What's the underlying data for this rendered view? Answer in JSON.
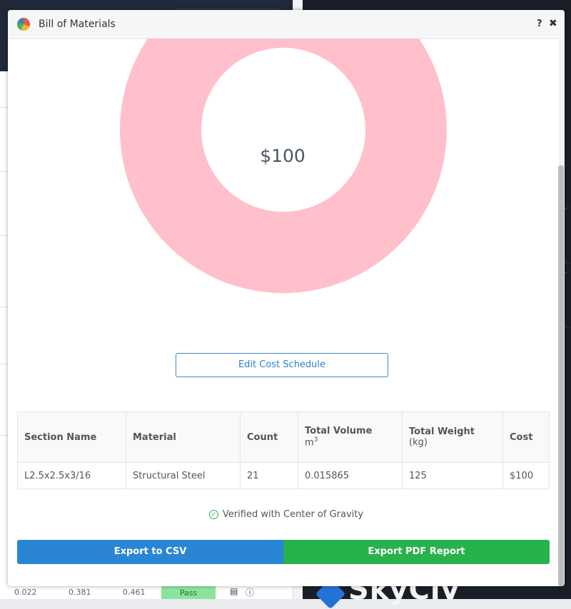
{
  "modal": {
    "title": "Bill of Materials",
    "help_label": "?",
    "close_label": "✖",
    "icon": "pie-chart-icon"
  },
  "donut": {
    "center_value": "$100",
    "color": "#ffc0cb"
  },
  "chart_data": {
    "type": "pie",
    "categories": [
      "L2.5x2.5x3/16"
    ],
    "values": [
      100
    ]
  },
  "edit_button_label": "Edit Cost Schedule",
  "table": {
    "headers": {
      "section_name": "Section Name",
      "material": "Material",
      "count": "Count",
      "total_volume": "Total Volume",
      "total_volume_unit": "m",
      "total_volume_exp": "3",
      "total_weight": "Total Weight",
      "total_weight_unit": "(kg)",
      "cost": "Cost"
    },
    "rows": [
      {
        "section_name": "L2.5x2.5x3/16",
        "material": "Structural Steel",
        "count": "21",
        "total_volume": "0.015865",
        "total_weight": "125",
        "cost": "$100"
      }
    ]
  },
  "verified_text": "Verified with Center of Gravity",
  "buttons": {
    "export_csv": "Export to CSV",
    "export_pdf": "Export PDF Report"
  },
  "background": {
    "bottom_row": [
      "0.022",
      "0.381",
      "0.461",
      "Pass"
    ],
    "logo_text": "SkyCiv",
    "colors": {
      "csv": "#2a86d4",
      "pdf": "#28b24b",
      "pass": "#8be49b"
    }
  }
}
